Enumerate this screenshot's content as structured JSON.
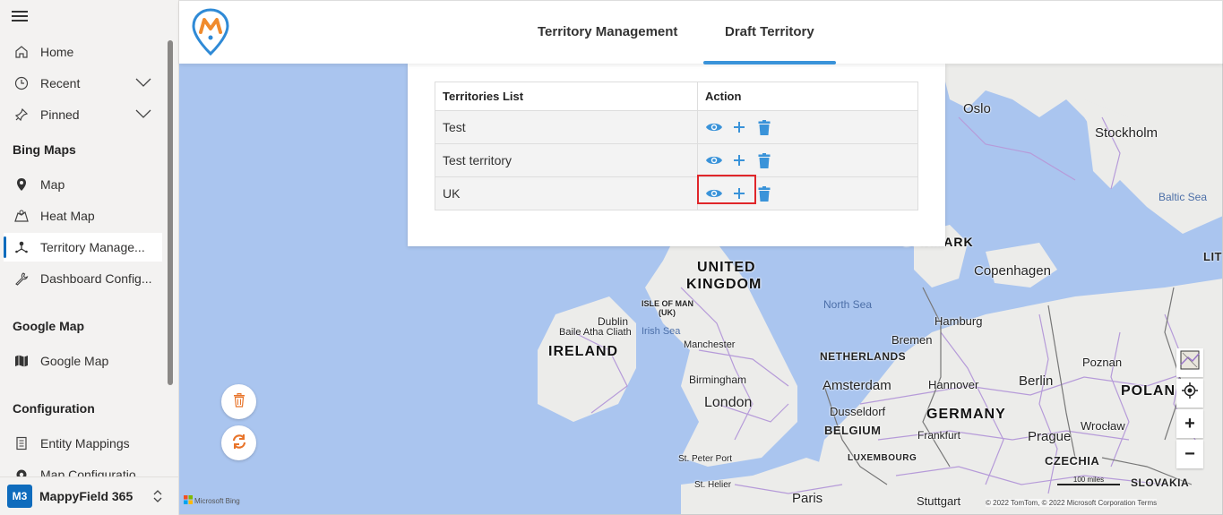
{
  "sidebar": {
    "items": [
      {
        "label": "Home",
        "icon": "home-icon"
      },
      {
        "label": "Recent",
        "icon": "clock-icon"
      },
      {
        "label": "Pinned",
        "icon": "pin-icon"
      }
    ],
    "sections": {
      "bing_maps": "Bing Maps",
      "google_map": "Google Map",
      "configuration": "Configuration"
    },
    "bing_items": [
      {
        "label": "Map",
        "icon": "map-pin-icon"
      },
      {
        "label": "Heat Map",
        "icon": "heat-map-icon"
      },
      {
        "label": "Territory Manage...",
        "icon": "territory-icon",
        "active": true
      },
      {
        "label": "Dashboard Config...",
        "icon": "wrench-icon"
      }
    ],
    "google_items": [
      {
        "label": "Google Map",
        "icon": "book-map-icon"
      }
    ],
    "config_items": [
      {
        "label": "Entity Mappings",
        "icon": "document-icon"
      },
      {
        "label": "Map Configuratio",
        "icon": "gear-icon"
      }
    ],
    "app": {
      "avatar": "M3",
      "name": "MappyField 365"
    }
  },
  "header": {
    "tabs": [
      {
        "label": "Territory Management"
      },
      {
        "label": "Draft Territory",
        "active": true
      }
    ],
    "accent": "#3a93d9"
  },
  "territories": {
    "columns": [
      "Territories List",
      "Action"
    ],
    "rows": [
      {
        "name": "Test"
      },
      {
        "name": "Test territory"
      },
      {
        "name": "UK",
        "highlighted": true
      }
    ],
    "action_icons": [
      "eye-icon",
      "plus-icon",
      "trash-icon"
    ],
    "icon_color": "#3a93d9",
    "highlight_color": "#e0262a"
  },
  "map": {
    "labels": {
      "oslo": "Oslo",
      "stockholm": "Stockholm",
      "baltic": "Baltic Sea",
      "denmark": "DENMARK",
      "copenhagen": "Copenhagen",
      "uk1": "UNITED",
      "uk2": "KINGDOM",
      "north_sea": "North Sea",
      "isle1": "ISLE OF MAN",
      "isle2": "(UK)",
      "dublin": "Dublin",
      "baile": "Baile Atha Cliath",
      "irish_sea": "Irish Sea",
      "ireland": "IRELAND",
      "manchester": "Manchester",
      "birmingham": "Birmingham",
      "london": "London",
      "hamburg": "Hamburg",
      "bremen": "Bremen",
      "netherlands": "NETHERLANDS",
      "amsterdam": "Amsterdam",
      "hannover": "Hannover",
      "berlin": "Berlin",
      "poznan": "Poznan",
      "poland": "POLAN",
      "dusseldorf": "Dusseldorf",
      "germany": "GERMANY",
      "belgium": "BELGIUM",
      "wroclaw": "Wrocław",
      "frankfurt": "Frankfurt",
      "prague": "Prague",
      "luxembourg": "LUXEMBOURG",
      "czechia": "CZECHIA",
      "st_peter": "St. Peter Port",
      "st_helier": "St. Helier",
      "paris": "Paris",
      "stuttgart": "Stuttgart",
      "slovakia": "SLOVAKIA",
      "lith": "LIT"
    },
    "bing": "Microsoft Bing",
    "copyright": "© 2022 TomTom, © 2022 Microsoft Corporation  Terms",
    "scale": "100 miles",
    "controls": [
      "map-style-icon",
      "locate-icon",
      "zoom-in-icon",
      "zoom-out-icon"
    ],
    "zoom_in": "+",
    "zoom_out": "−",
    "floating": [
      "trash-icon",
      "refresh-icon"
    ]
  }
}
